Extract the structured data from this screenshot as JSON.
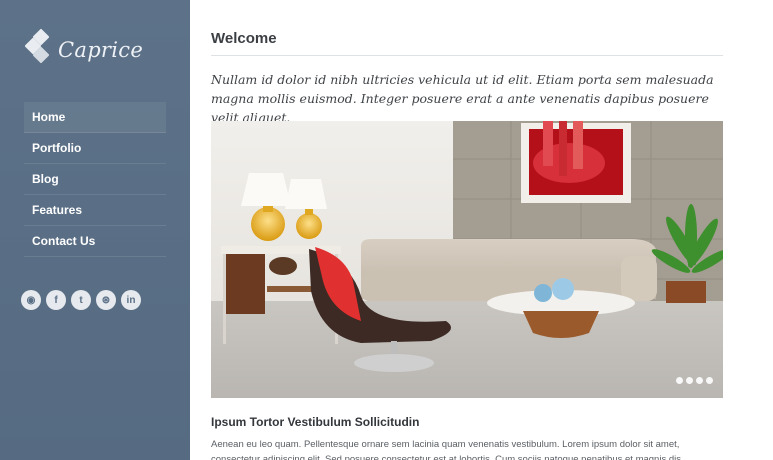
{
  "brand": {
    "name": "Caprice"
  },
  "nav": {
    "items": [
      {
        "label": "Home",
        "active": true
      },
      {
        "label": "Portfolio"
      },
      {
        "label": "Blog"
      },
      {
        "label": "Features"
      },
      {
        "label": "Contact Us"
      }
    ]
  },
  "social": [
    {
      "icon": "rss-icon",
      "glyph": "◉"
    },
    {
      "icon": "facebook-icon",
      "glyph": "f"
    },
    {
      "icon": "twitter-icon",
      "glyph": "t"
    },
    {
      "icon": "dribbble-icon",
      "glyph": "⊛"
    },
    {
      "icon": "linkedin-icon",
      "glyph": "in"
    }
  ],
  "main": {
    "title": "Welcome",
    "intro": "Nullam id dolor id nibh ultricies vehicula ut id elit. Etiam porta sem malesuada magna mollis euismod. Integer posuere erat a ante venenatis dapibus posuere velit aliquet.",
    "slider": {
      "slides": 4,
      "active": 1
    },
    "post_title": "Ipsum Tortor Vestibulum Sollicitudin",
    "post_body": "Aenean eu leo quam. Pellentesque ornare sem lacinia quam venenatis vestibulum. Lorem ipsum dolor sit amet, consectetur adipiscing elit. Sed posuere consectetur est at lobortis. Cum sociis natoque penatibus et magnis dis"
  },
  "colors": {
    "sidebar": "#5c7189",
    "text": "#3b3f44"
  }
}
